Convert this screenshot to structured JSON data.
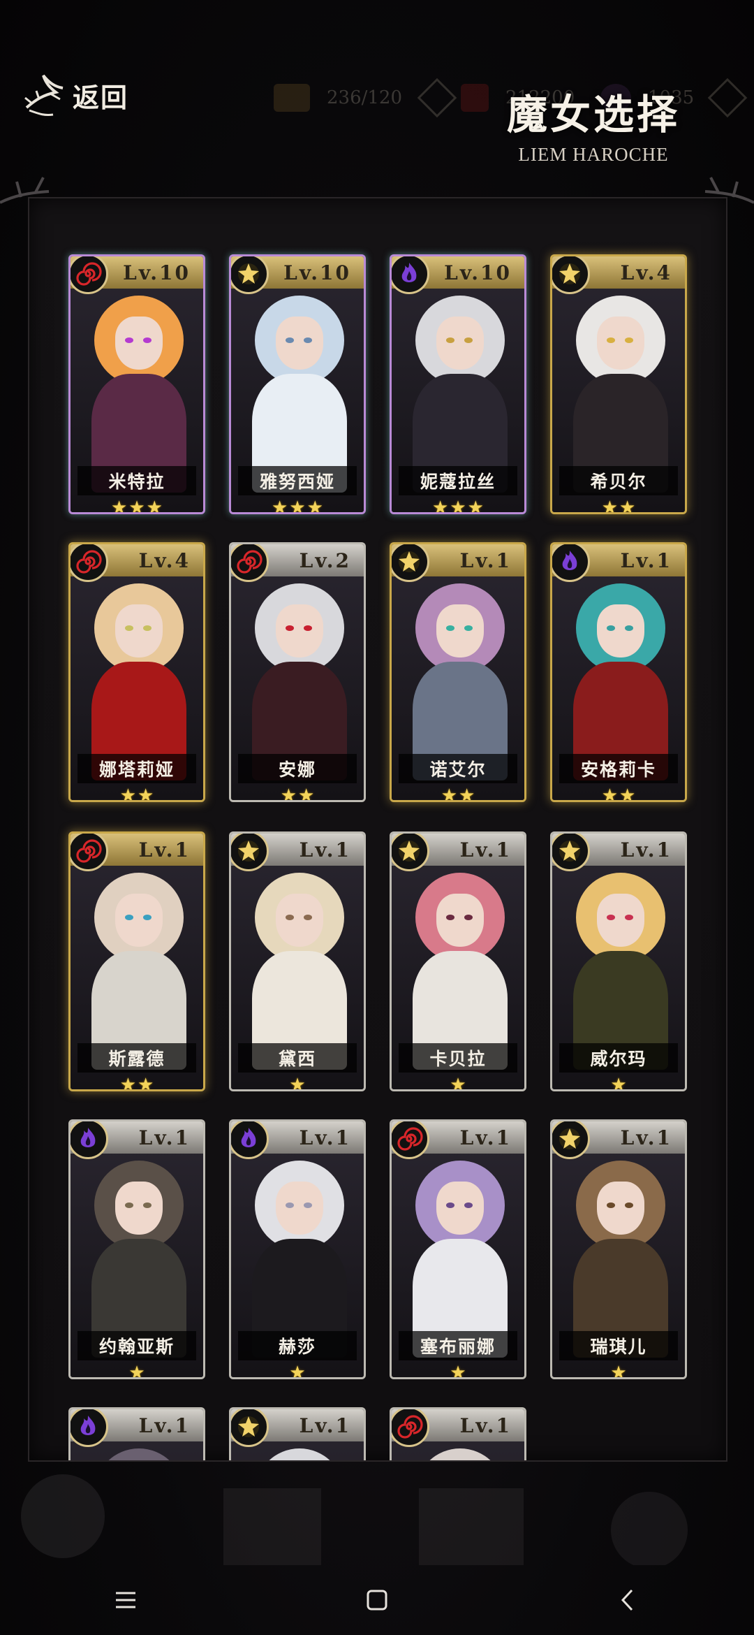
{
  "header": {
    "back_label": "返回",
    "title": "魔女选择",
    "subtitle": "LIEM HAROCHE"
  },
  "resources": [
    {
      "icon": "card-icon",
      "value": "236/120"
    },
    {
      "icon": "potion-icon",
      "value": "212200"
    },
    {
      "icon": "gem-icon",
      "value": "1035"
    }
  ],
  "colors": {
    "gold_frame": "#c9a84a",
    "silver_frame": "#bdbab2",
    "star": "#f3d35a",
    "element_red": "#d8262a",
    "element_purple": "#7b3fd6",
    "element_light": "#f2d36a"
  },
  "cards": [
    {
      "name": "米特拉",
      "level": "Lv.10",
      "element": "red-spiral-icon",
      "stars": "★★★",
      "frame": "rainbow"
    },
    {
      "name": "雅努西娅",
      "level": "Lv.10",
      "element": "light-star-icon",
      "stars": "★★★",
      "frame": "rainbow"
    },
    {
      "name": "妮蔻拉丝",
      "level": "Lv.10",
      "element": "purple-flame-icon",
      "stars": "★★★",
      "frame": "rainbow"
    },
    {
      "name": "希贝尔",
      "level": "Lv.4",
      "element": "light-star-icon",
      "stars": "★★",
      "frame": "gold"
    },
    {
      "name": "娜塔莉娅",
      "level": "Lv.4",
      "element": "red-spiral-icon",
      "stars": "★★",
      "frame": "gold"
    },
    {
      "name": "安娜",
      "level": "Lv.2",
      "element": "red-spiral-icon",
      "stars": "★★",
      "frame": "silver"
    },
    {
      "name": "诺艾尔",
      "level": "Lv.1",
      "element": "light-star-icon",
      "stars": "★★",
      "frame": "gold"
    },
    {
      "name": "安格莉卡",
      "level": "Lv.1",
      "element": "purple-flame-icon",
      "stars": "★★",
      "frame": "gold"
    },
    {
      "name": "斯露德",
      "level": "Lv.1",
      "element": "red-spiral-icon",
      "stars": "★★",
      "frame": "gold"
    },
    {
      "name": "黛西",
      "level": "Lv.1",
      "element": "light-star-icon",
      "stars": "★",
      "frame": "silver"
    },
    {
      "name": "卡贝拉",
      "level": "Lv.1",
      "element": "light-star-icon",
      "stars": "★",
      "frame": "silver"
    },
    {
      "name": "威尔玛",
      "level": "Lv.1",
      "element": "light-star-icon",
      "stars": "★",
      "frame": "silver"
    },
    {
      "name": "约翰亚斯",
      "level": "Lv.1",
      "element": "purple-flame-icon",
      "stars": "★",
      "frame": "silver"
    },
    {
      "name": "赫莎",
      "level": "Lv.1",
      "element": "purple-flame-icon",
      "stars": "★",
      "frame": "silver"
    },
    {
      "name": "塞布丽娜",
      "level": "Lv.1",
      "element": "red-spiral-icon",
      "stars": "★",
      "frame": "silver"
    },
    {
      "name": "瑞琪儿",
      "level": "Lv.1",
      "element": "light-star-icon",
      "stars": "★",
      "frame": "silver"
    },
    {
      "name": "",
      "level": "Lv.1",
      "element": "purple-flame-icon",
      "stars": "",
      "frame": "silver"
    },
    {
      "name": "",
      "level": "Lv.1",
      "element": "light-star-icon",
      "stars": "",
      "frame": "silver"
    },
    {
      "name": "",
      "level": "Lv.1",
      "element": "red-spiral-icon",
      "stars": "",
      "frame": "silver"
    }
  ],
  "system_nav": [
    {
      "icon": "menu-lines-icon"
    },
    {
      "icon": "home-square-icon"
    },
    {
      "icon": "back-chevron-icon"
    }
  ]
}
